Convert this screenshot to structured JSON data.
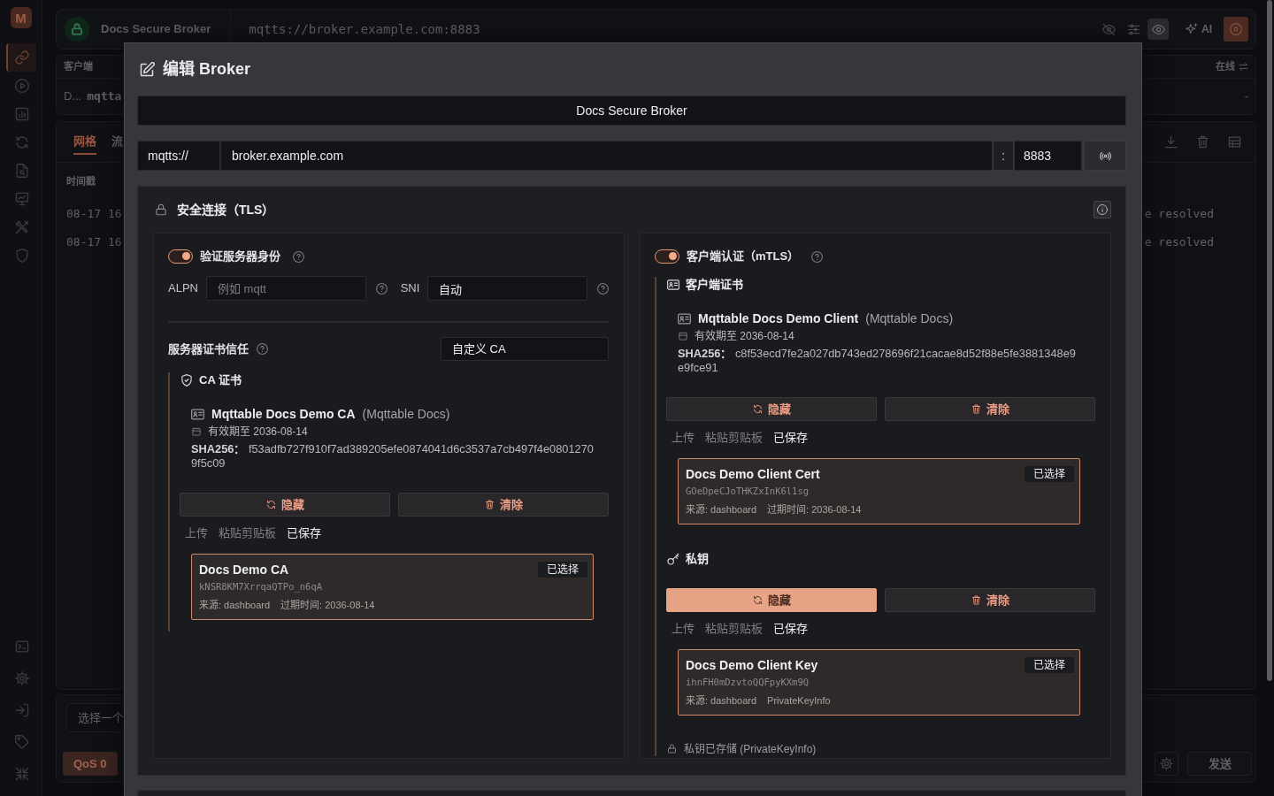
{
  "sidebar": {
    "logo": "M",
    "items": [
      {
        "selected": true
      },
      {
        "selected": false
      },
      {
        "selected": false
      },
      {
        "selected": false
      },
      {
        "selected": false
      },
      {
        "selected": false
      },
      {
        "selected": false
      },
      {
        "selected": false
      }
    ],
    "footer_items": [
      {
        "selected": false
      },
      {
        "selected": false
      },
      {
        "selected": false
      },
      {
        "selected": false
      },
      {
        "selected": false
      }
    ]
  },
  "background": {
    "top_bar": {
      "name": "Docs Secure Broker",
      "url": "mqtts://broker.example.com:8883",
      "tools": [
        {
          "selected": false
        },
        {
          "selected": false
        },
        {
          "selected": true
        }
      ],
      "ai_label": "AI"
    },
    "clients": {
      "header": "客户端",
      "status_header": "在线",
      "row": {
        "name": "D...",
        "client_id": "mqtta",
        "status": "-"
      }
    },
    "messages": {
      "tabs": [
        {
          "label": "网格",
          "selected": true
        },
        {
          "label": "流",
          "selected": false
        }
      ],
      "column_header": "时间戳",
      "rows": [
        {
          "time": "08-17 16",
          "text": "e resolved"
        },
        {
          "time": "08-17 16",
          "text": "e resolved"
        }
      ]
    },
    "composer": {
      "placeholder": "选择一个",
      "qos": "QoS 0",
      "send": "发送"
    }
  },
  "dialog": {
    "title": "编辑 Broker",
    "name": "Docs Secure Broker",
    "url": {
      "protocol": "mqtts://",
      "host": "broker.example.com",
      "separator": ":",
      "port": "8883"
    },
    "tls": {
      "title": "安全连接（TLS）",
      "columns": [
        {
          "toggle": {
            "label": "验证服务器身份",
            "on": true
          },
          "fields": [
            {
              "label": "ALPN",
              "placeholder": "例如 mqtt"
            },
            {
              "label": "SNI",
              "value": "自动"
            }
          ],
          "trust": {
            "label": "服务器证书信任",
            "value": "自定义 CA"
          },
          "groups": [
            {
              "kind": "ca",
              "title": "CA 证书",
              "info": {
                "name": "Mqttable Docs Demo CA",
                "issuer": "(Mqttable Docs)",
                "validity": "有效期至 2036-08-14",
                "fingerprint": "**SHA256：** f53adfb727f910f7ad389205efe0874041d6c3537a7cb497f4e08012709f5c09"
              },
              "buttons": [
                {
                  "kind": "hide",
                  "label": "隐藏",
                  "active": false
                },
                {
                  "kind": "clear",
                  "label": "清除",
                  "active": false
                }
              ],
              "tabs": [
                {
                  "label": "上传",
                  "selected": false
                },
                {
                  "label": "粘贴剪贴板",
                  "selected": false
                },
                {
                  "label": "已保存",
                  "selected": true
                }
              ],
              "saved": [
                {
                  "title": "Docs Demo CA",
                  "badge": "已选择",
                  "selected": true,
                  "id": "kNSR8KM7XrrqaQTPo_n6qA",
                  "meta": [
                    "来源: dashboard",
                    "过期时间: 2036-08-14"
                  ]
                }
              ]
            }
          ]
        },
        {
          "toggle": {
            "label": "客户端认证（mTLS）",
            "on": true
          },
          "groups": [
            {
              "kind": "cert",
              "title": "客户端证书",
              "info": {
                "name": "Mqttable Docs Demo Client",
                "issuer": "(Mqttable Docs)",
                "validity": "有效期至 2036-08-14",
                "fingerprint": "**SHA256：** c8f53ecd7fe2a027db743ed278696f21cacae8d52f88e5fe3881348e9e9fce91"
              },
              "buttons": [
                {
                  "kind": "hide",
                  "label": "隐藏",
                  "active": false
                },
                {
                  "kind": "clear",
                  "label": "清除",
                  "active": false
                }
              ],
              "tabs": [
                {
                  "label": "上传",
                  "selected": false
                },
                {
                  "label": "粘贴剪贴板",
                  "selected": false
                },
                {
                  "label": "已保存",
                  "selected": true
                }
              ],
              "saved": [
                {
                  "title": "Docs Demo Client Cert",
                  "badge": "已选择",
                  "selected": true,
                  "id": "GOeDpeCJoTHKZxInK6l1sg",
                  "meta": [
                    "来源: dashboard",
                    "过期时间: 2036-08-14"
                  ]
                }
              ]
            },
            {
              "kind": "key",
              "title": "私钥",
              "buttons": [
                {
                  "kind": "hide",
                  "label": "隐藏",
                  "active": true
                },
                {
                  "kind": "clear",
                  "label": "清除",
                  "active": false
                }
              ],
              "tabs": [
                {
                  "label": "上传",
                  "selected": false
                },
                {
                  "label": "粘贴剪贴板",
                  "selected": false
                },
                {
                  "label": "已保存",
                  "selected": true
                }
              ],
              "saved": [
                {
                  "title": "Docs Demo Client Key",
                  "badge": "已选择",
                  "selected": true,
                  "id": "ihnFH0mDzvtoQQFpyKXm9Q",
                  "meta": [
                    "来源: dashboard",
                    "PrivateKeyInfo"
                  ]
                }
              ]
            }
          ],
          "note": "私钥已存储 (PrivateKeyInfo)"
        }
      ]
    }
  }
}
